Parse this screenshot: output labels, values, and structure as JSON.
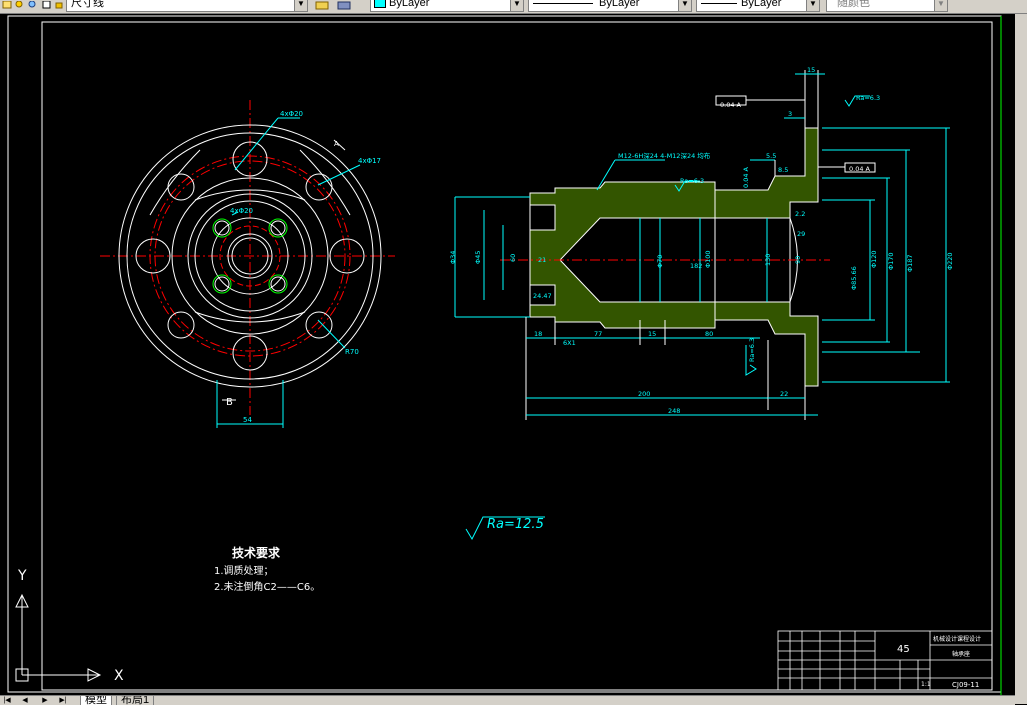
{
  "toolbar": {
    "layer_name": "尺寸线",
    "color_value": "ByLayer",
    "linetype_value": "ByLayer",
    "lineweight_value": "ByLayer",
    "plotstyle_value": "随颜色"
  },
  "drawing": {
    "left_view": {
      "callout_holes_large": "4xΦ20",
      "callout_holes_medium": "4xΦ17",
      "callout_holes_small": "4xΦ20",
      "callout_radius": "R70",
      "section_mark": "B",
      "dim_width": "54",
      "section_letter": "A"
    },
    "section_view": {
      "thread_note": "M12-6H深24 4-M12深24 均布",
      "roughness_top": "Ra=6.3",
      "roughness_flange": "Ra=6.3",
      "roughness_right": "Ra=6.3",
      "dim_15": "15",
      "dim_3": "3",
      "dim_chamfer_5": "5.5",
      "dim_chamfer_85": "8.5",
      "dim_r2": "2.2",
      "dim_r29": "29",
      "dim_d70": "Φ70",
      "dim_d100": "Φ100",
      "dim_d130": "130",
      "dim_d90": "90",
      "dim_d120": "Φ120",
      "dim_d170": "Φ170",
      "dim_d187": "Φ187",
      "dim_d220": "Φ220",
      "dim_d34": "Φ34",
      "dim_d45": "Φ45",
      "dim_d60": "60",
      "dim_d85": "Φ85.66",
      "dim_21": "21",
      "dim_24": "24.47",
      "dim_182": "182",
      "dim_18": "18",
      "dim_6x1": "6X1",
      "dim_77": "77",
      "dim_15b": "15",
      "dim_80": "80",
      "dim_200": "200",
      "dim_22": "22",
      "dim_248": "248",
      "tol_box_1": "0.04 A",
      "tol_box_2": "0.04 A",
      "tol_box_3": "0.04 A"
    },
    "roughness_global": "Ra=12.5",
    "tech_req": {
      "title": "技术要求",
      "line1": "1.调质处理；",
      "line2": "2.未注倒角C2——C6。"
    },
    "title_block": {
      "material": "45",
      "project": "机械设计课程设计",
      "part": "轴承座",
      "scale": "1:1",
      "drawing_no": "CJ09-11"
    },
    "ucs": {
      "y_label": "Y",
      "x_label": "X"
    }
  },
  "tabs": {
    "model": "模型",
    "layout1": "布局1"
  }
}
